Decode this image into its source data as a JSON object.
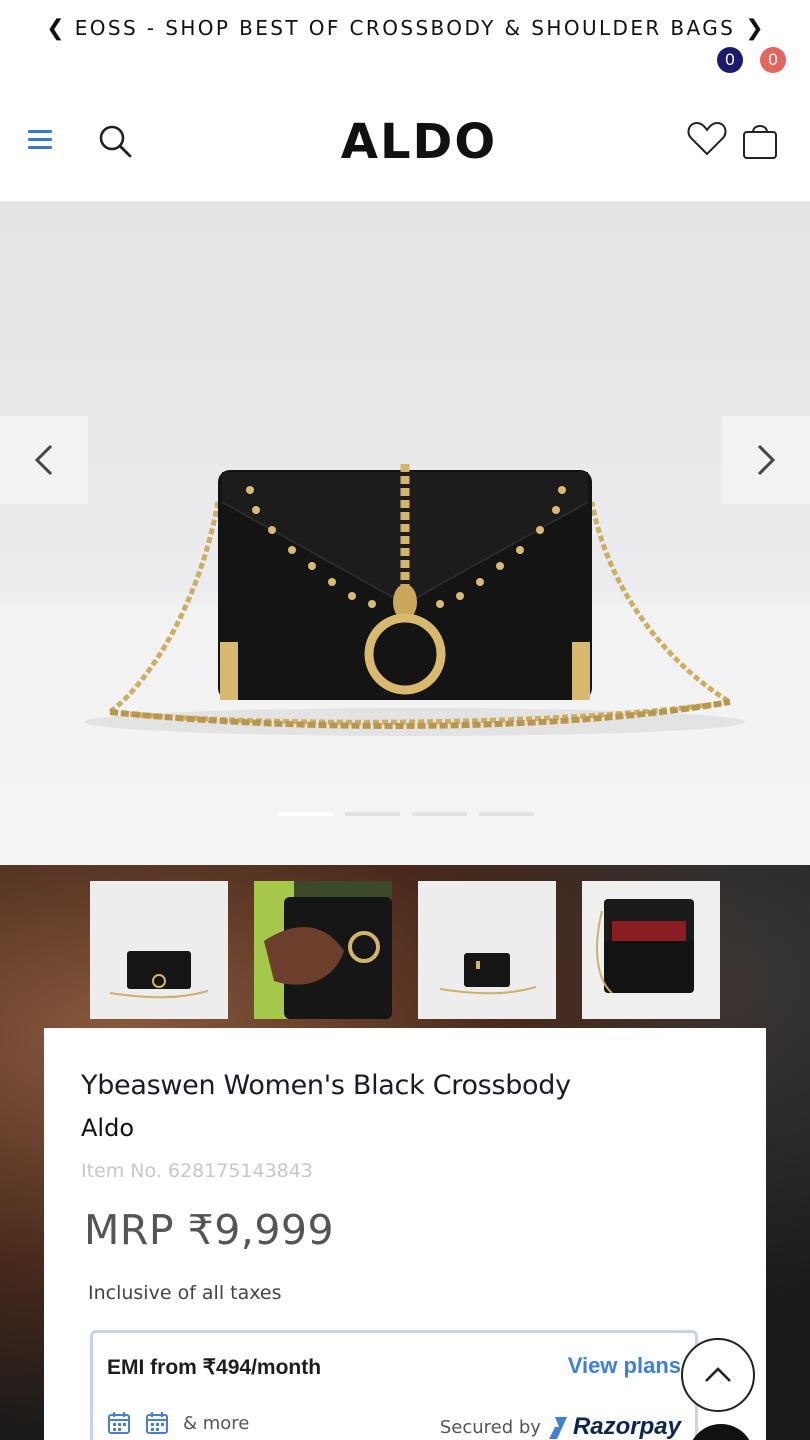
{
  "announcement": {
    "prev_icon": "chevron-left-icon",
    "text": "EOSS - SHOP BEST OF CROSSBODY & SHOULDER BAGS",
    "next_icon": "chevron-right-icon"
  },
  "header": {
    "menu_icon": "hamburger-menu-icon",
    "search_icon": "search-icon",
    "logo_text": "ALDO",
    "wishlist_count": "0",
    "bag_count": "0",
    "colors": {
      "menu": "#3a78d0",
      "wishlist_badge": "#1b1a6b",
      "bag_badge": "#e2665e"
    }
  },
  "gallery": {
    "prev_icon": "chevron-left-icon",
    "next_icon": "chevron-right-icon",
    "slide_count": 4,
    "active_slide": 1,
    "thumbnails": [
      "front-view",
      "in-hand-view",
      "side-view",
      "open-interior-view"
    ]
  },
  "product": {
    "title": "Ybeaswen Women's Black Crossbody",
    "brand": "Aldo",
    "item_no": "Item No. 628175143843",
    "price": "MRP ₹9,999",
    "taxes_note": "Inclusive of all taxes"
  },
  "emi": {
    "text": "EMI from ₹494/month",
    "link": "View plans",
    "more": "& more",
    "secured_by": "Secured by",
    "provider": "Razorpay",
    "colors": {
      "link": "#3d7fd9",
      "border": "#c7d3ea"
    }
  },
  "scroll_top_icon": "chevron-up-icon"
}
